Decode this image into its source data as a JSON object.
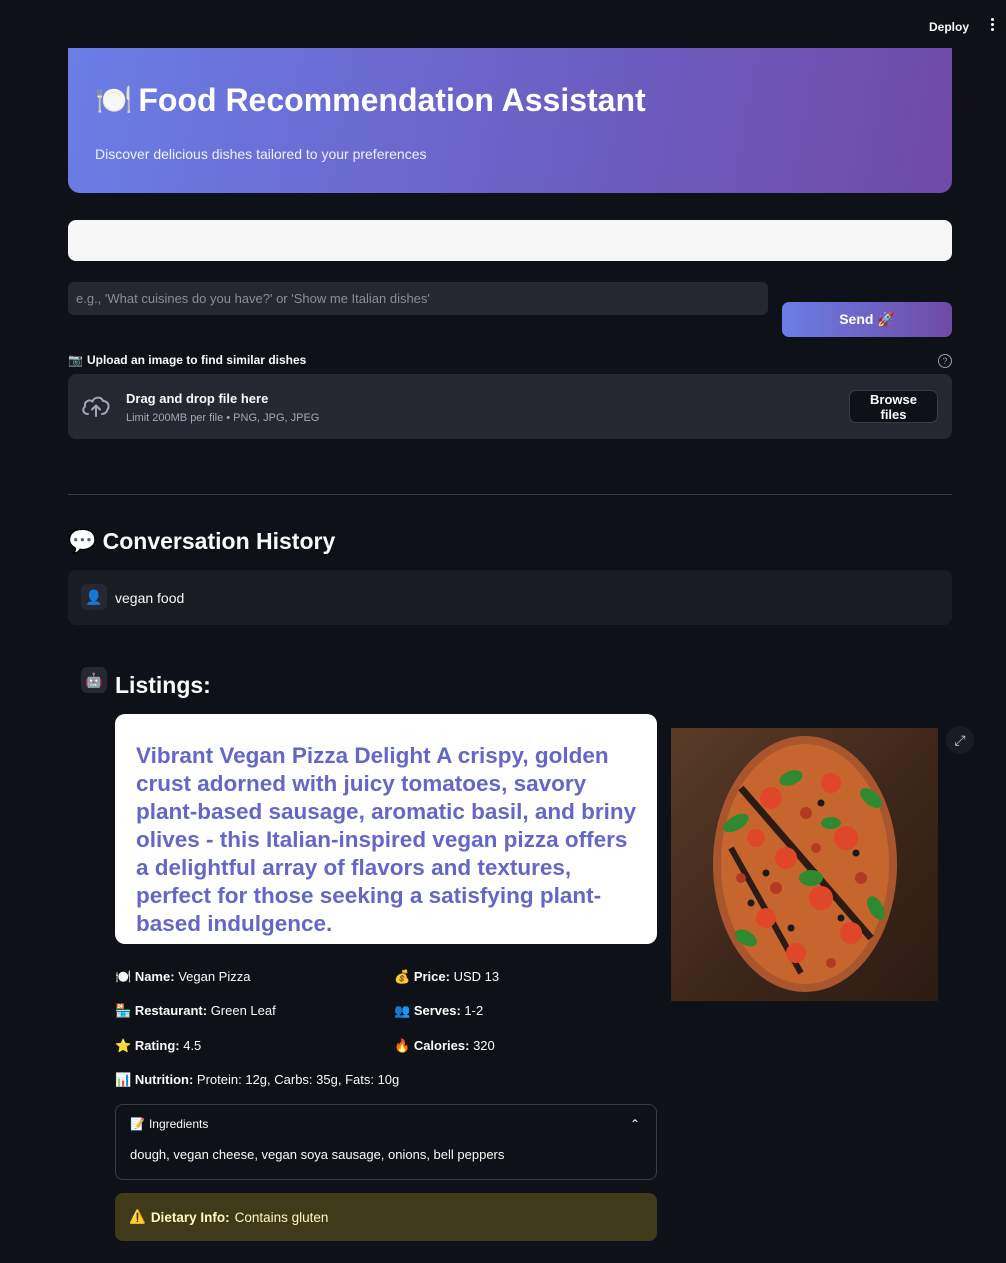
{
  "topbar": {
    "deploy_label": "Deploy"
  },
  "hero": {
    "icon": "🍽️",
    "title": "Food Recommendation Assistant",
    "subtitle": "Discover delicious dishes tailored to your preferences",
    "gradient_start": "#6a7ee6",
    "gradient_end": "#6f4aa6"
  },
  "query": {
    "value": "",
    "placeholder": "e.g., 'What cuisines do you have?' or 'Show me Italian dishes'",
    "send_label": "Send 🚀"
  },
  "upload": {
    "icon": "📷",
    "label": "Upload an image to find similar dishes",
    "help": "?",
    "dropzone_title": "Drag and drop file here",
    "dropzone_limits": "Limit 200MB per file • PNG, JPG, JPEG",
    "browse_label": "Browse files"
  },
  "conversation": {
    "icon": "💬",
    "title": "Conversation History",
    "user_avatar": "👤",
    "user_message": "vegan food",
    "bot_avatar": "🤖",
    "listings_title": "Listings:"
  },
  "listing": {
    "description": "Vibrant Vegan Pizza Delight A crispy, golden crust adorned with juicy tomatoes, savory plant-based sausage, aromatic basil, and briny olives - this Italian-inspired vegan pizza offers a delightful array of flavors and textures, perfect for those seeking a satisfying plant-based indulgence.",
    "description_color": "#6466c8",
    "facts": {
      "name": {
        "icon": "🍽️",
        "label": "Name:",
        "value": "Vegan Pizza"
      },
      "price": {
        "icon": "💰",
        "label": "Price:",
        "value": "USD 13"
      },
      "restaurant": {
        "icon": "🏪",
        "label": "Restaurant:",
        "value": "Green Leaf"
      },
      "serves": {
        "icon": "👥",
        "label": "Serves:",
        "value": "1-2"
      },
      "rating": {
        "icon": "⭐",
        "label": "Rating:",
        "value": "4.5"
      },
      "calories": {
        "icon": "🔥",
        "label": "Calories:",
        "value": "320"
      },
      "nutrition": {
        "icon": "📊",
        "label": "Nutrition:",
        "value": "Protein: 12g, Carbs: 35g, Fats: 10g"
      }
    },
    "ingredients": {
      "icon": "📝",
      "label": "Ingredients",
      "value": "dough, vegan cheese, vegan soya sausage, onions, bell peppers"
    },
    "dietary": {
      "icon": "⚠️",
      "label": "Dietary Info:",
      "value": "Contains gluten"
    }
  }
}
